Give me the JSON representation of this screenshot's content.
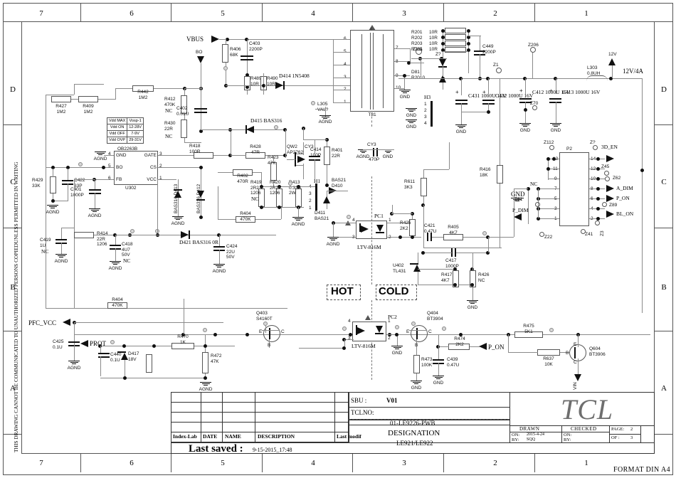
{
  "sheet": {
    "format": "FORMAT DIN A4",
    "side_notice": "THIS DRAWING CANNOT BE COMMUNICATED TO UNAUTHORIZED PERSONS COPIEDUNLESS  PERMITTED IN WRITING",
    "zones_x": [
      "7",
      "6",
      "5",
      "4",
      "3",
      "2",
      "1"
    ],
    "zones_y": [
      "D",
      "C",
      "B",
      "A"
    ]
  },
  "title_block": {
    "sbu_label": "SBU :",
    "sbu_value": "V01",
    "tclno_label": "TCLNO:",
    "tclno_value": "01-LE9226-PWB",
    "designation_label": "DESIGNATION",
    "designation_value": "LE921/LE922",
    "brand": "TCL",
    "drawn_label": "DRAWN",
    "drawn_on_label": "ON:",
    "drawn_on_value": "2015-4-24",
    "drawn_by_label": "BY:",
    "drawn_by_value": "SQQ",
    "checked_label": "CHECKED",
    "checked_on_label": "ON:",
    "checked_by_label": "BY:",
    "page_label": "PAGE:",
    "page_value": "2",
    "of_label": "OF :",
    "of_value": "3",
    "cols": [
      "Index-Lab",
      "DATE",
      "NAME",
      "DESCRIPTION",
      "Last modif"
    ],
    "last_saved_label": "Last saved :",
    "last_saved_value": "9-15-2015_17:48"
  },
  "vdd_table": {
    "rows": [
      [
        "Vdd MAX",
        "Vosp-1"
      ],
      [
        "Vdd  ON",
        "12-28V"
      ],
      [
        "Vdd OFF",
        "7-9V"
      ],
      [
        "Vdd OVP",
        "29-31V"
      ]
    ]
  },
  "ics": {
    "u302": {
      "part": "OB2263B",
      "ref": "U302",
      "pins": [
        "GND",
        "GATE",
        "BO",
        "CS",
        "FB",
        "VCC"
      ],
      "pin_nums": [
        "4",
        "3",
        "5",
        "2",
        "6",
        "1"
      ]
    },
    "u402": {
      "ref": "U402",
      "part": "TL431"
    },
    "pc1": {
      "ref": "PC1",
      "part": "LTV-816M",
      "pins": [
        "4",
        "1",
        "3",
        "2"
      ]
    },
    "pc2": {
      "ref": "PC2",
      "part": "LTV-816M",
      "pins": [
        "4",
        "1",
        "3",
        "2"
      ]
    },
    "t81": {
      "ref": "T81",
      "left_pins": [
        "6",
        "5",
        "4",
        "3",
        "2",
        "1"
      ],
      "right_pins": [
        "7",
        "8",
        "9",
        "10"
      ]
    },
    "p2": {
      "ref": "P2",
      "left_pins": [
        "13",
        "11",
        "9",
        "7",
        "5",
        "3",
        "1"
      ],
      "right_pins": [
        "14",
        "12",
        "10",
        "8",
        "6",
        "4",
        "2"
      ]
    },
    "h1": {
      "ref": "H1",
      "pins": [
        "4",
        "3",
        "2",
        "1"
      ]
    },
    "h3": {
      "ref": "H3",
      "pins": [
        "1",
        "2",
        "3",
        "4"
      ]
    }
  },
  "nets": [
    {
      "name": "VBUS"
    },
    {
      "name": "BO"
    },
    {
      "name": "12V"
    },
    {
      "name": "12V/4A"
    },
    {
      "name": "PFC_VCC"
    },
    {
      "name": "PROT"
    },
    {
      "name": "P_ON"
    },
    {
      "name": "VIN"
    },
    {
      "name": "3D_EN"
    },
    {
      "name": "A_DIM"
    },
    {
      "name": "BL_ON"
    },
    {
      "name": "P_DIM"
    },
    {
      "name": "GND"
    },
    {
      "name": "AGND"
    },
    {
      "name": "NC"
    },
    {
      "name": "HOT"
    },
    {
      "name": "COLD"
    }
  ],
  "components": [
    {
      "ref": "R427",
      "val": "1M2"
    },
    {
      "ref": "R409",
      "val": "1M2"
    },
    {
      "ref": "R442",
      "val": "1M2"
    },
    {
      "ref": "R412",
      "val": "470K",
      "note": "NC"
    },
    {
      "ref": "R430",
      "val": "22R",
      "note": "NC"
    },
    {
      "ref": "C402",
      "val": "0.01U"
    },
    {
      "ref": "R406",
      "val": "68K"
    },
    {
      "ref": "C403",
      "val": "2200P"
    },
    {
      "ref": "R489",
      "val": "10R"
    },
    {
      "ref": "R490",
      "val": "10R"
    },
    {
      "ref": "D414",
      "val": "1N5408"
    },
    {
      "ref": "L305",
      "val": "VAL?"
    },
    {
      "ref": "R429",
      "val": "33K"
    },
    {
      "ref": "C422",
      "val": "33P"
    },
    {
      "ref": "C401",
      "val": "1000P"
    },
    {
      "ref": "D413",
      "val": "BAS316"
    },
    {
      "ref": "D412",
      "val": "BAS316"
    },
    {
      "ref": "C419",
      "val": "1U",
      "note": "NC"
    },
    {
      "ref": "R414",
      "val": "22R 1206"
    },
    {
      "ref": "C418",
      "val": "4U7 50V",
      "note": "NC"
    },
    {
      "ref": "D421",
      "val": "BAS316 0R"
    },
    {
      "ref": "C424",
      "val": "22U 50V"
    },
    {
      "ref": "R418",
      "val": "100R"
    },
    {
      "ref": "D415",
      "val": "BAS316"
    },
    {
      "ref": "R428",
      "val": "47R"
    },
    {
      "ref": "R402",
      "val": "470R"
    },
    {
      "ref": "R423",
      "val": "47K"
    },
    {
      "ref": "QW2",
      "val": "AP2762"
    },
    {
      "ref": "C414",
      "val": "100P"
    },
    {
      "ref": "R419",
      "val": "2R2 1206",
      "note": "NC"
    },
    {
      "ref": "R420",
      "val": "2R2 1206"
    },
    {
      "ref": "R413",
      "val": "0.33R 2W"
    },
    {
      "ref": "R404",
      "val": "470K"
    },
    {
      "ref": "R401",
      "val": "22R"
    },
    {
      "ref": "D410",
      "val": "BAS21"
    },
    {
      "ref": "D411",
      "val": "BAS21"
    },
    {
      "ref": "CY3",
      "val": "470P"
    },
    {
      "ref": "R201",
      "val": "10R"
    },
    {
      "ref": "R202",
      "val": "10R"
    },
    {
      "ref": "R203",
      "val": "10R"
    },
    {
      "ref": "R205",
      "val": "10R"
    },
    {
      "ref": "C449",
      "val": "2200P"
    },
    {
      "ref": "D81",
      "val": "R2010"
    },
    {
      "ref": "C431",
      "val": "1000U 16V"
    },
    {
      "ref": "C432",
      "val": "1000U 16V"
    },
    {
      "ref": "C412",
      "val": "1000U 16V"
    },
    {
      "ref": "C413",
      "val": "1000U 16V"
    },
    {
      "ref": "L303",
      "val": "0.8UH"
    },
    {
      "ref": "R416",
      "val": "18K"
    },
    {
      "ref": "R611",
      "val": "3K3"
    },
    {
      "ref": "R425",
      "val": "2K2"
    },
    {
      "ref": "C421",
      "val": "0.47U"
    },
    {
      "ref": "R405",
      "val": "4K7"
    },
    {
      "ref": "C417",
      "val": "1000P"
    },
    {
      "ref": "R417",
      "val": "4K7"
    },
    {
      "ref": "R426",
      "val": "NC"
    },
    {
      "ref": "C425",
      "val": "0.1U"
    },
    {
      "ref": "Q403",
      "val": "S4160T"
    },
    {
      "ref": "C440",
      "val": "0.1U"
    },
    {
      "ref": "D417",
      "val": "18V"
    },
    {
      "ref": "R470",
      "val": "1K"
    },
    {
      "ref": "R472",
      "val": "47K"
    },
    {
      "ref": "Q404",
      "val": "BT3904"
    },
    {
      "ref": "R473",
      "val": "100K"
    },
    {
      "ref": "C439",
      "val": "0.47U"
    },
    {
      "ref": "R474",
      "val": "2K2"
    },
    {
      "ref": "R475",
      "val": "5K1"
    },
    {
      "ref": "R637",
      "val": "10K"
    },
    {
      "ref": "Q604",
      "val": "BT3906"
    }
  ],
  "testpoints": [
    "Z111",
    "Z7",
    "Z1",
    "Z206",
    "Z70",
    "Z112",
    "Z45",
    "Z62",
    "Z61",
    "Z22",
    "Z41",
    "Z89",
    "Z3"
  ],
  "labels": {
    "vbus": "VBUS",
    "bo": "BO",
    "v12": "12V",
    "v12_4a": "12V/4A",
    "pfc_vcc": "PFC_VCC",
    "prot": "PROT",
    "p_on": "P_ON",
    "vin": "VIN",
    "d3_en": "3D_EN",
    "a_dim": "A_DIM",
    "bl_on": "BL_ON",
    "p_dim": "P_DIM",
    "gnd": "GND",
    "agnd": "AGND",
    "nc": "NC",
    "hot": "HOT",
    "cold": "COLD"
  }
}
